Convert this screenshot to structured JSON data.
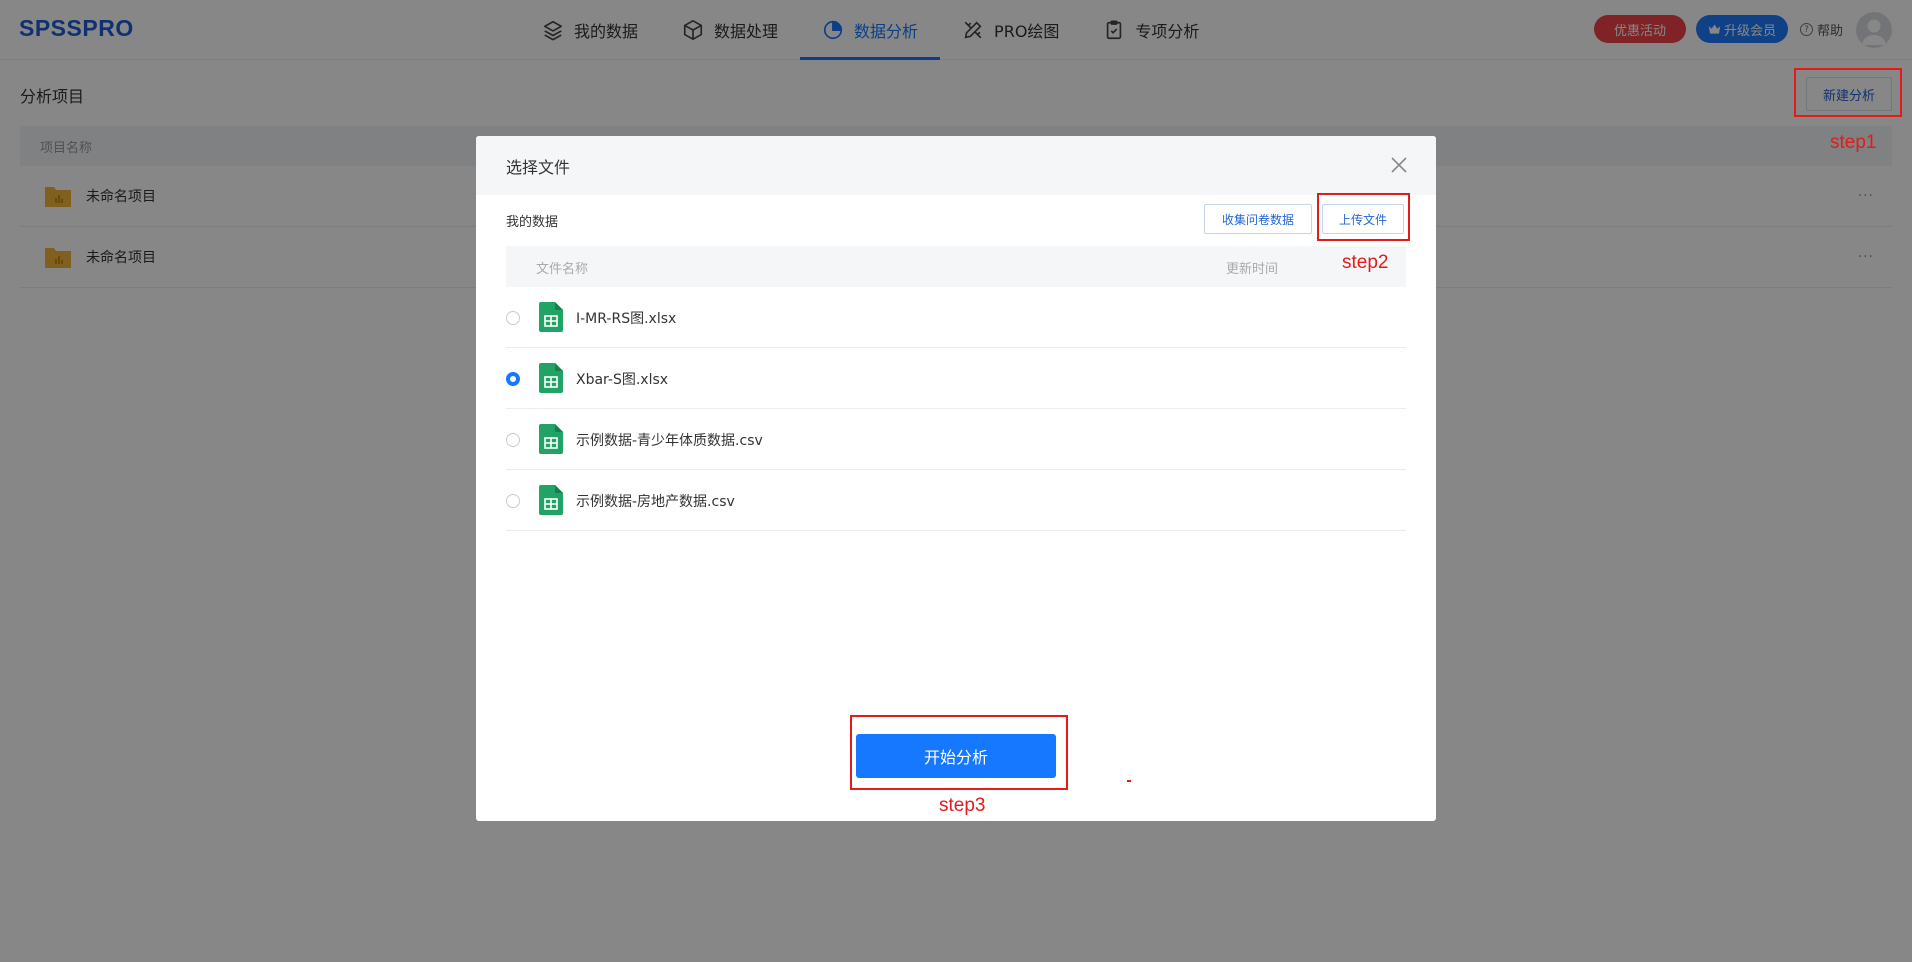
{
  "header": {
    "logo": "SPSSPRO",
    "nav": [
      {
        "label": "我的数据",
        "icon": "layers-icon"
      },
      {
        "label": "数据处理",
        "icon": "cube-icon"
      },
      {
        "label": "数据分析",
        "icon": "pie-chart-icon",
        "active": true
      },
      {
        "label": "PRO绘图",
        "icon": "pencil-ruler-icon"
      },
      {
        "label": "专项分析",
        "icon": "clipboard-check-icon"
      }
    ],
    "promo_label": "优惠活动",
    "vip_label": "升级会员",
    "help_label": "帮助"
  },
  "page": {
    "title": "分析项目",
    "new_button": "新建分析",
    "column_name": "项目名称",
    "projects": [
      {
        "name": "未命名项目"
      },
      {
        "name": "未命名项目"
      }
    ],
    "more_symbol": "···"
  },
  "modal": {
    "title": "选择文件",
    "subtitle": "我的数据",
    "survey_button": "收集问卷数据",
    "upload_button": "上传文件",
    "col_file_name": "文件名称",
    "col_update_time": "更新时间",
    "files": [
      {
        "name": "I-MR-RS图.xlsx",
        "selected": false
      },
      {
        "name": "Xbar-S图.xlsx",
        "selected": true
      },
      {
        "name": "示例数据-青少年体质数据.csv",
        "selected": false
      },
      {
        "name": "示例数据-房地产数据.csv",
        "selected": false
      }
    ],
    "start_button": "开始分析"
  },
  "annotations": {
    "step1": "step1",
    "step2": "step2",
    "step3": "step3",
    "color": "#e21b1b"
  },
  "colors": {
    "primary": "#1677ff",
    "promo": "#f0424b",
    "logo": "#1e5dd6",
    "file_icon": "#21a366"
  }
}
